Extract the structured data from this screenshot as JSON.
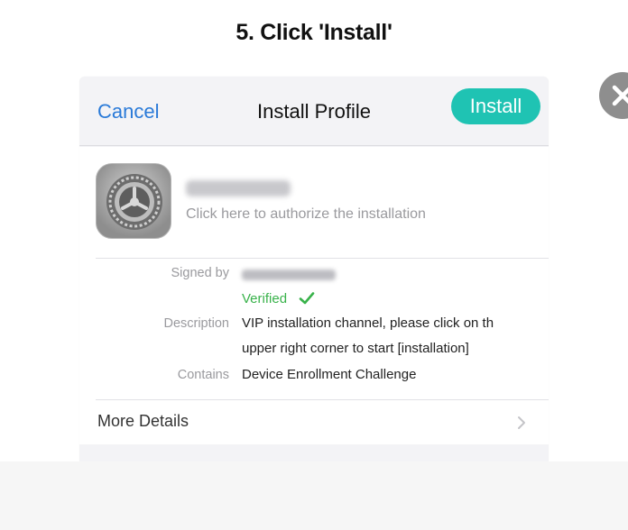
{
  "instruction": {
    "title": "5. Click 'Install'"
  },
  "nav": {
    "cancel_label": "Cancel",
    "title": "Install Profile",
    "install_label": "Install"
  },
  "profile": {
    "subtitle": "Click here to authorize the installation",
    "signed_by_label": "Signed by",
    "verified_label": "Verified",
    "description_label": "Description",
    "description_line1": "VIP installation channel, please click on th",
    "description_line2": "upper right corner to start [installation]",
    "contains_label": "Contains",
    "contains_value": "Device Enrollment Challenge"
  },
  "more_details_label": "More Details",
  "icons": {
    "app": "settings-gear-icon",
    "verified": "checkmark-icon",
    "more": "chevron-right-icon",
    "close": "close-icon"
  },
  "colors": {
    "accent_blue": "#2a7ad8",
    "install_teal": "#1fc3b3",
    "verified_green": "#38b24a",
    "close_gray": "#8e8e8e"
  }
}
